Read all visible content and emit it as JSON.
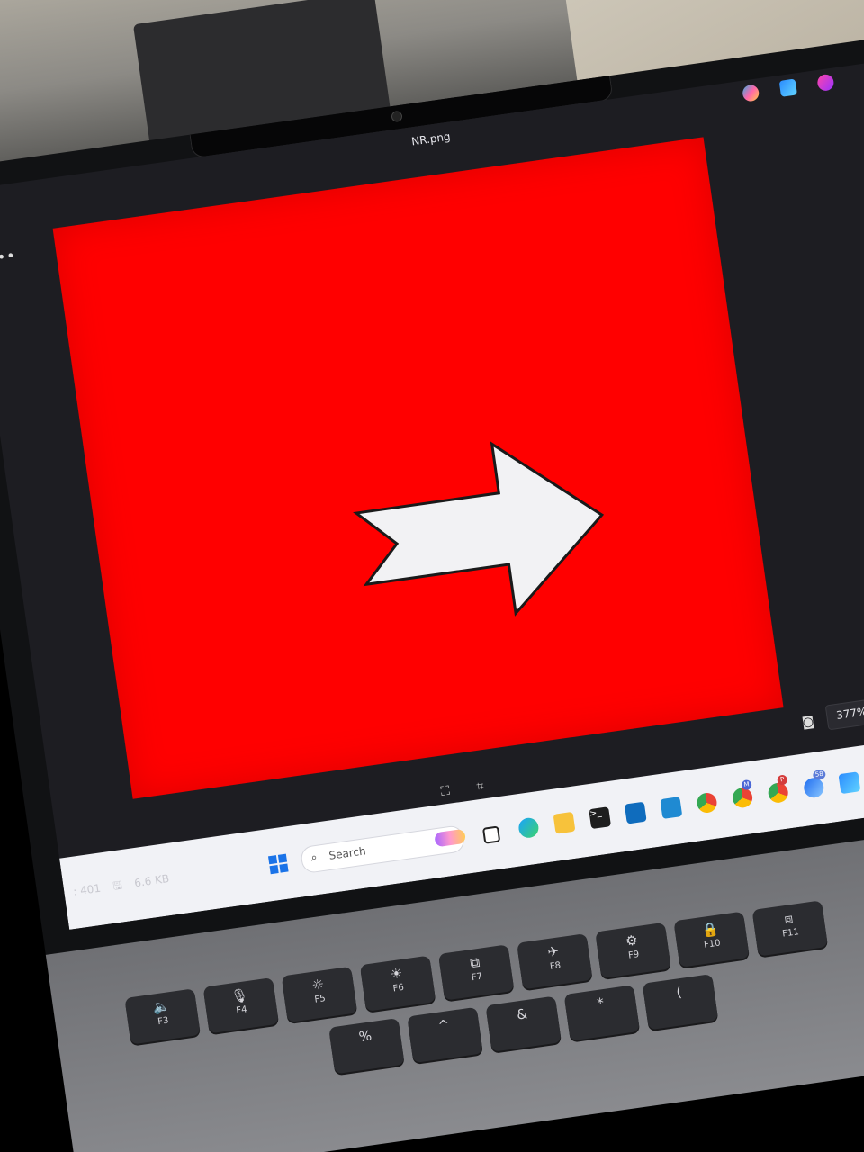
{
  "window": {
    "title": "NR.png",
    "more_label": "•••"
  },
  "top_apps": {
    "copilot_icon": "copilot-icon",
    "photos_icon": "photos-app-icon",
    "designer_icon": "designer-icon"
  },
  "viewer": {
    "background_color": "#ff0000",
    "arrow_fill": "#f2f2f4",
    "arrow_direction": "right",
    "zoom_value": "377%",
    "zoom_chevron": "⌄",
    "camera_icon": "◙",
    "fit_icon": "⛶",
    "crop_icon": "⌗"
  },
  "file_info": {
    "dimensions_fragment": ": 401",
    "disk_icon": "🖫",
    "size": "6.6 KB"
  },
  "taskbar": {
    "search_placeholder": "Search",
    "search_icon": "⌕",
    "terminal_glyph": ">_",
    "badges": {
      "m": "M",
      "p": "P",
      "count": "58"
    }
  },
  "keyboard": {
    "keys": [
      {
        "sym": "🔈",
        "label": "F3"
      },
      {
        "sym": "🎙",
        "label": "F4"
      },
      {
        "sym": "☼",
        "label": "F5"
      },
      {
        "sym": "☀",
        "label": "F6"
      },
      {
        "sym": "⧉",
        "label": "F7"
      },
      {
        "sym": "✈",
        "label": "F8"
      },
      {
        "sym": "⚙",
        "label": "F9"
      },
      {
        "sym": "🔒",
        "label": "F10"
      },
      {
        "sym": "⧈",
        "label": "F11"
      }
    ],
    "row2": [
      {
        "sym": "%",
        "label": ""
      },
      {
        "sym": "^",
        "label": ""
      },
      {
        "sym": "&",
        "label": ""
      },
      {
        "sym": "*",
        "label": ""
      },
      {
        "sym": "(",
        "label": ""
      }
    ]
  }
}
